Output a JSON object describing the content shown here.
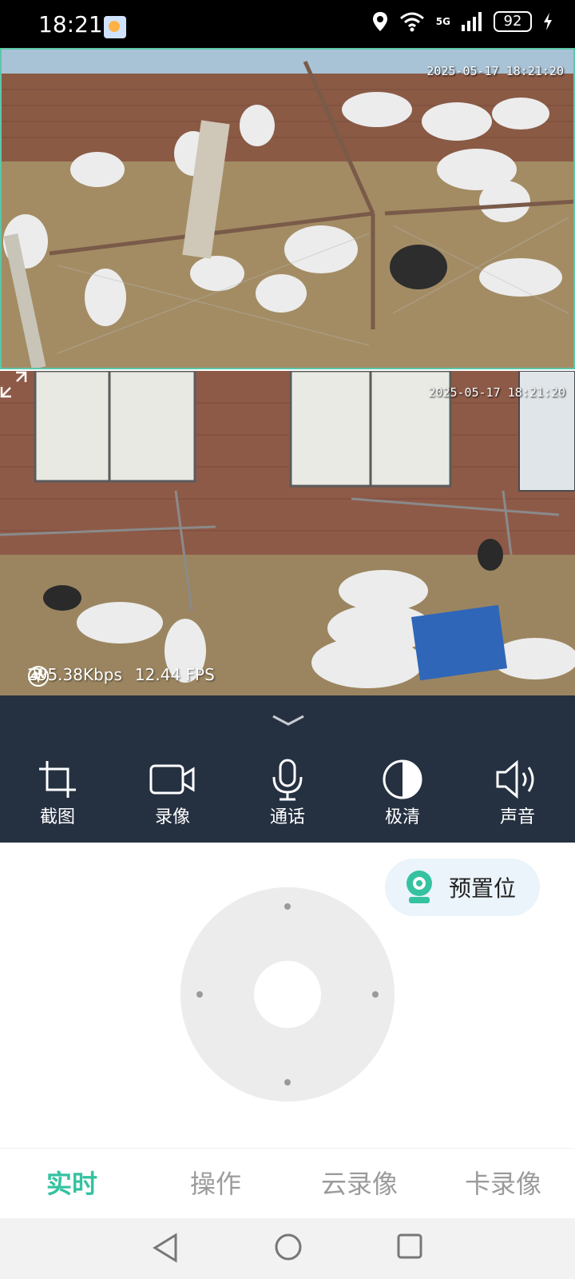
{
  "status_bar": {
    "time": "18:21",
    "network": "5G",
    "battery": "92"
  },
  "camera1": {
    "timestamp": "2025-05-17 18:21:20"
  },
  "camera2": {
    "timestamp": "2025-05-17 18:21:20",
    "bitrate": "295.38Kbps",
    "fps": "12.44 FPS"
  },
  "controls": {
    "screenshot_label": "截图",
    "record_label": "录像",
    "talk_label": "通话",
    "quality_label": "极清",
    "sound_label": "声音"
  },
  "preset": {
    "label": "预置位"
  },
  "tabs": [
    {
      "label": "实时"
    },
    {
      "label": "操作"
    },
    {
      "label": "云录像"
    },
    {
      "label": "卡录像"
    }
  ],
  "colors": {
    "accent": "#35c2a1",
    "panel_bg": "#253041",
    "camera_border": "#5bc7a8"
  }
}
